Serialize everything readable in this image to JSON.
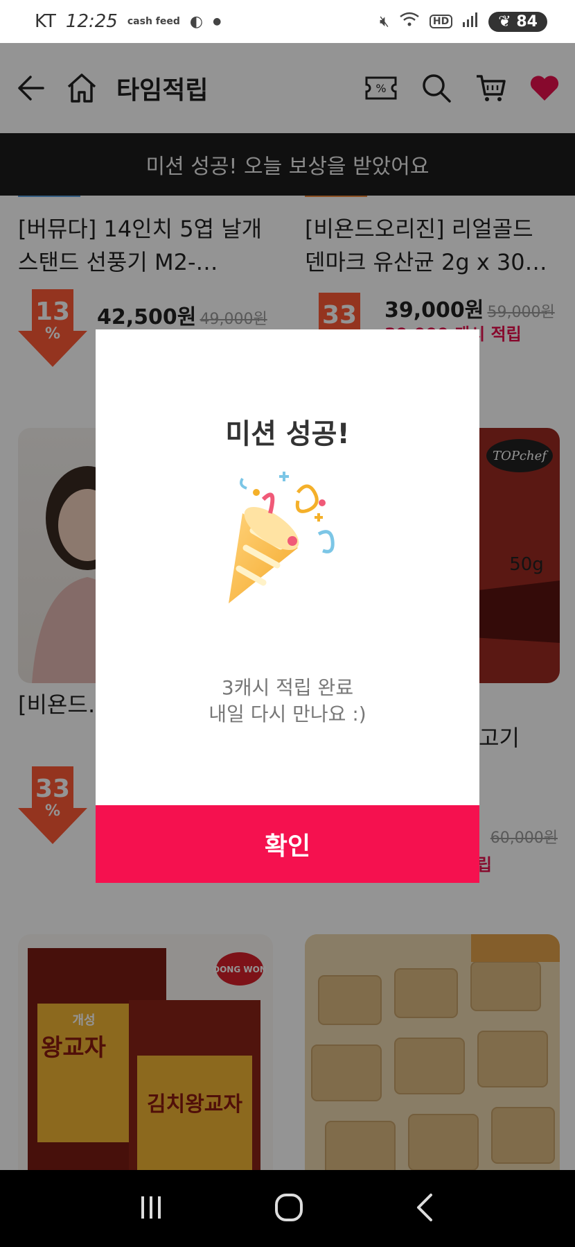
{
  "status_bar": {
    "carrier": "KT",
    "time": "12:25",
    "cashfeed": "cash feed",
    "battery": "84",
    "hd": "HD"
  },
  "header": {
    "title": "타임적립",
    "coupon_symbol": "%"
  },
  "banner": {
    "text": "미션 성공! 오늘 보상을 받았어요"
  },
  "products": [
    {
      "name": "[버뮤다] 14인치 5엽 날개 스탠드 선풍기 M2-…",
      "discount": "13",
      "pct": "%",
      "price": "42,500원",
      "original": "49,000원",
      "cash": ""
    },
    {
      "name": "[비욘드오리진] 리얼골드 덴마크 유산균 2g x 30…",
      "discount": "33",
      "pct": "%",
      "price": "39,000원",
      "original": "59,000원",
      "cash": "39,000 캐시 적립"
    },
    {
      "name": "[비욘드… 리미엄 4…",
      "discount": "33",
      "pct": "%",
      "price": "",
      "original": "",
      "cash": ""
    },
    {
      "name": "…고기",
      "discount": "",
      "pct": "",
      "price": "",
      "original": "60,000원",
      "cash": "적립",
      "thumb_brand": "TOPchef",
      "thumb_weight": "50g"
    },
    {
      "thumb_brand": "DONG WON",
      "thumb_label1": "개성",
      "thumb_label2": "왕교자",
      "thumb_label3": "김치왕교자"
    }
  ],
  "modal": {
    "title": "미션 성공!",
    "line1": "3캐시 적립 완료",
    "line2": "내일 다시 만나요 :)",
    "confirm": "확인"
  }
}
